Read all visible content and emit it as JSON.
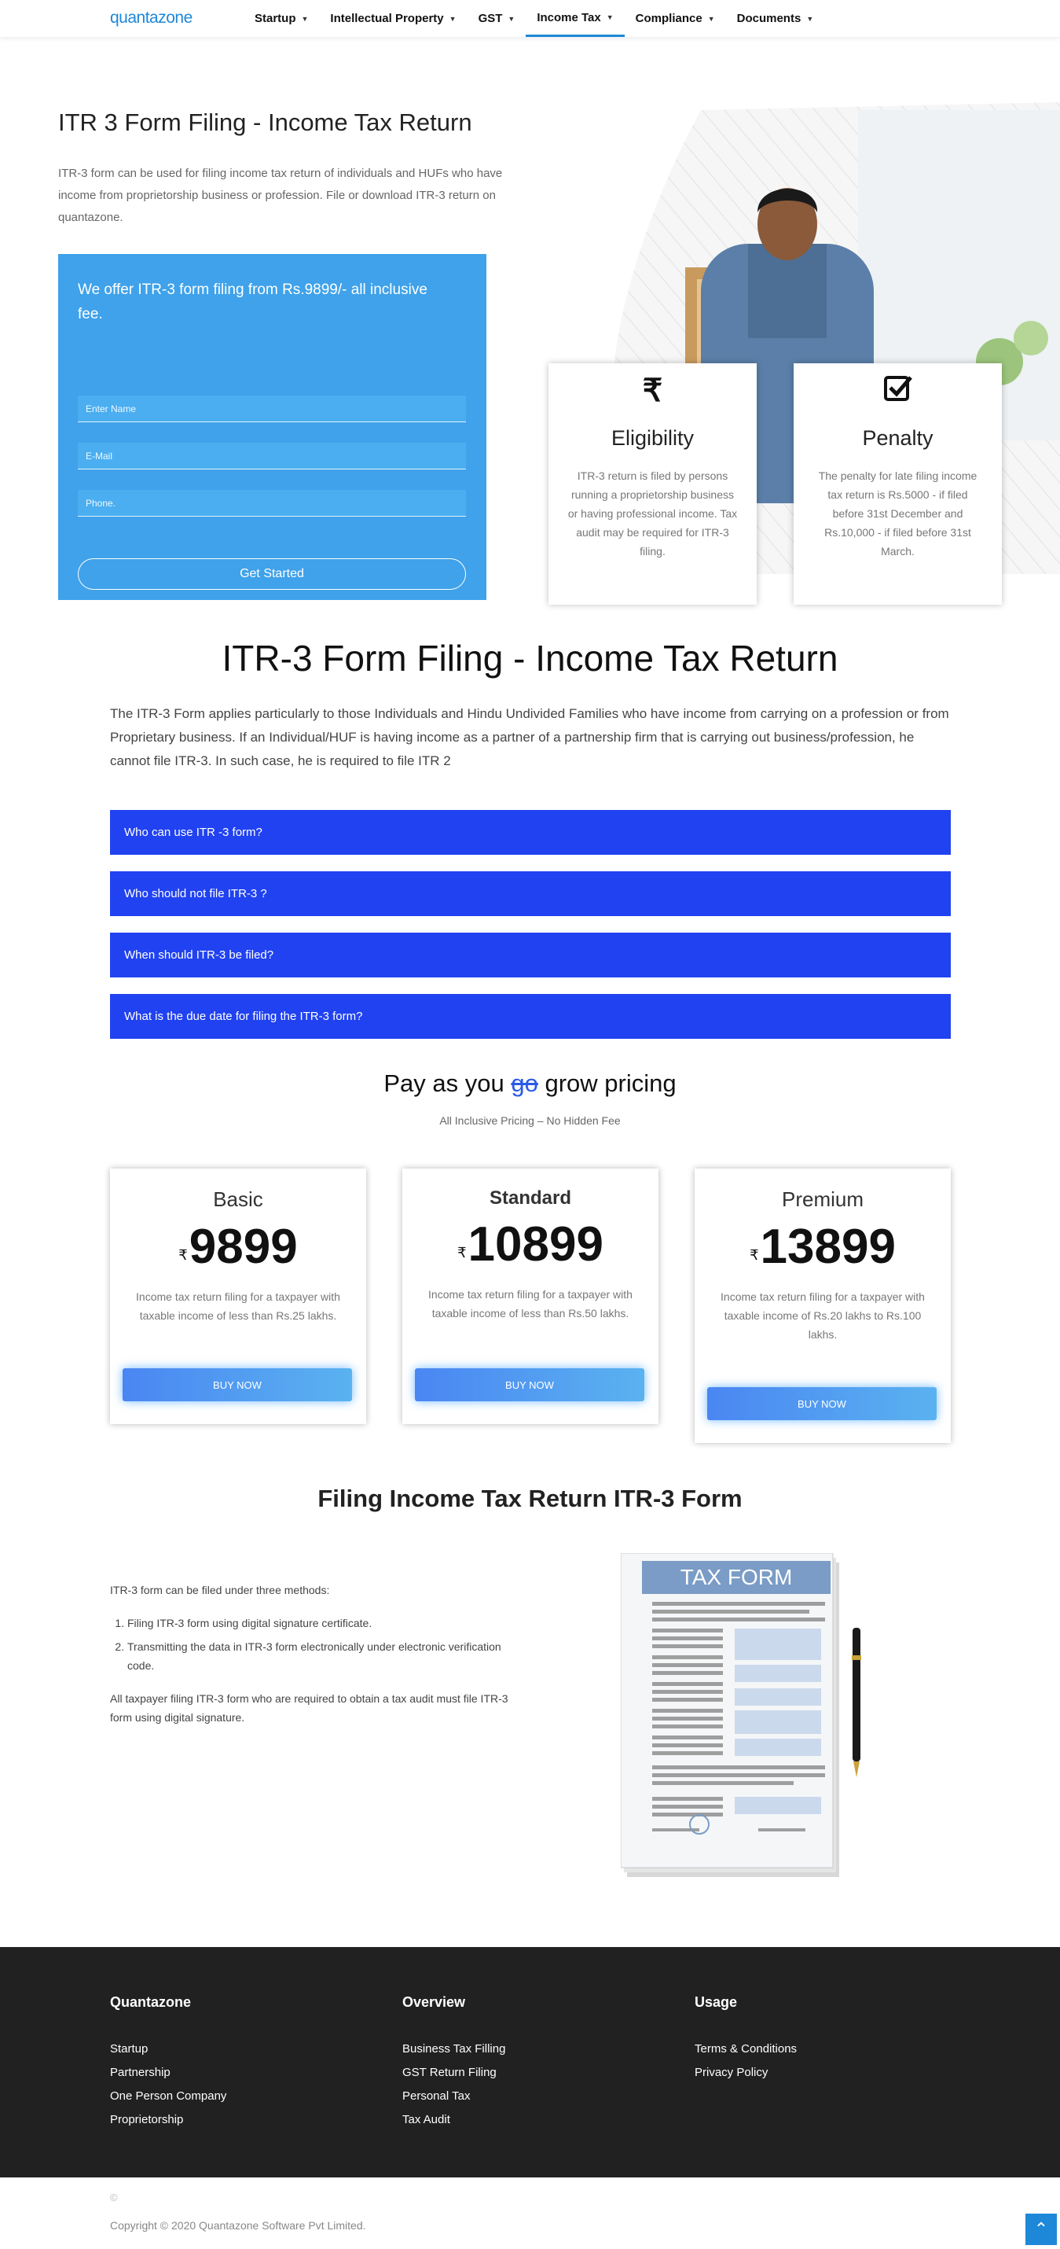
{
  "nav": {
    "logo": "quantazone",
    "items": [
      {
        "label": "Startup"
      },
      {
        "label": "Intellectual Property"
      },
      {
        "label": "GST"
      },
      {
        "label": "Income Tax"
      },
      {
        "label": "Compliance"
      },
      {
        "label": "Documents"
      }
    ],
    "active": "Income Tax"
  },
  "hero": {
    "title": "ITR 3 Form Filing - Income Tax Return",
    "description": "ITR-3 form can be used for filing income tax return of individuals and HUFs who have income from proprietorship business or profession. File or download ITR-3 return on quantazone.",
    "offer": "We offer ITR-3 form filing from Rs.9899/- all inclusive fee.",
    "name_placeholder": "Enter Name",
    "email_placeholder": "E-Mail",
    "phone_placeholder": "Phone.",
    "button": "Get Started"
  },
  "cards": [
    {
      "icon": "rupee-icon",
      "title": "Eligibility",
      "text": "ITR-3 return is filed by persons running a proprietorship business or having professional income. Tax audit may be required for ITR-3 filing."
    },
    {
      "icon": "checkbox-icon",
      "title": "Penalty",
      "text": "The penalty for late filing income tax return is Rs.5000 - if filed before 31st December and Rs.10,000 - if filed before 31st March."
    }
  ],
  "section2": {
    "title": "ITR-3 Form Filing - Income Tax Return",
    "description": "The ITR-3 Form applies particularly to those Individuals and Hindu Undivided Families who have income from carrying on a profession or from Proprietary business. If an Individual/HUF is having income as a partner of a partnership firm that is carrying out business/profession, he cannot file ITR-3. In such case, he is required to file ITR 2",
    "faqs": [
      "Who can use ITR -3 form?",
      "Who should not file ITR-3 ?",
      "When should ITR-3 be filed?",
      "What is the due date for filing the ITR-3 form?"
    ]
  },
  "pricing": {
    "title_a": "Pay as you",
    "title_strike": "go",
    "title_b": "grow pricing",
    "subtitle": "All Inclusive Pricing – No Hidden Fee",
    "currency": "₹",
    "plans": [
      {
        "name": "Basic",
        "amount": "9899",
        "desc": "Income tax return filing for a taxpayer with taxable income of less than Rs.25 lakhs.",
        "button": "BUY NOW"
      },
      {
        "name": "Standard",
        "amount": "10899",
        "desc": "Income tax return filing for a taxpayer with taxable income of less than Rs.50 lakhs.",
        "button": "BUY NOW"
      },
      {
        "name": "Premium",
        "amount": "13899",
        "desc": "Income tax return filing for a taxpayer with taxable income of Rs.20 lakhs to Rs.100 lakhs.",
        "button": "BUY NOW"
      }
    ]
  },
  "filing": {
    "title": "Filing Income Tax Return ITR-3 Form",
    "intro": "ITR-3 form can be filed under three methods:",
    "methods": [
      "Filing ITR-3 form using digital signature certificate.",
      "Transmitting the data in ITR-3 form electronically under electronic verification code."
    ],
    "outro": "All taxpayer filing ITR-3 form who are required to obtain a tax audit must file ITR-3 form using digital signature.",
    "image_label": "TAX FORM"
  },
  "footer": {
    "cols": [
      {
        "title": "Quantazone",
        "links": [
          "Startup",
          "Partnership",
          "One Person Company",
          "Proprietorship"
        ]
      },
      {
        "title": "Overview",
        "links": [
          "Business Tax Filling",
          "GST Return Filing",
          "Personal Tax",
          "Tax Audit"
        ]
      },
      {
        "title": "Usage",
        "links": [
          "Terms & Conditions",
          "Privacy Policy"
        ]
      }
    ],
    "copyright_symbol": "©",
    "copyright": "Copyright © 2020 Quantazone Software Pvt Limited."
  },
  "colors": {
    "brand": "#1e88d8",
    "accordion": "#2142f0",
    "offer_box": "#3fa2ea",
    "footer": "#212121"
  }
}
